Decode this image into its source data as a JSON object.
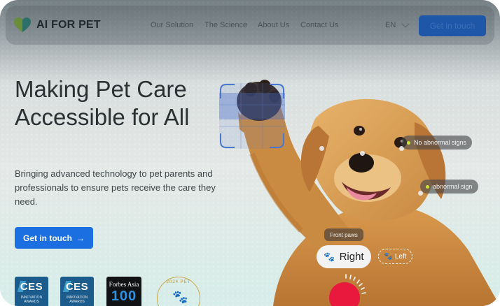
{
  "brand": {
    "name": "AI FOR PET"
  },
  "nav": {
    "items": [
      "Our Solution",
      "The Science",
      "About Us",
      "Contact Us"
    ],
    "language": "EN",
    "cta": "Get in touch"
  },
  "hero": {
    "title": "Making Pet Care Accessible for All",
    "subtitle": "Bringing advanced technology to pet parents and professionals to ensure pets receive the care they need.",
    "cta": "Get in touch",
    "cta_arrow": "→"
  },
  "badges": {
    "ces1": {
      "logo": "CES",
      "caption": "INNOVATION AWARDS"
    },
    "ces2": {
      "logo": "CES",
      "caption": "INNOVATION AWARDS"
    },
    "forbes": {
      "top": "Forbes Asia",
      "num": "100"
    },
    "award": {
      "text": "2024 PET"
    }
  },
  "overlay": {
    "tag1": "No abnormal signs",
    "tag2": "abnormal sign",
    "front_label": "Front paws",
    "right_label": "Right",
    "left_label": "Left"
  },
  "colors": {
    "accent": "#1b6fe0",
    "record": "#e8193c",
    "tag_dot": "#c8e33a"
  }
}
